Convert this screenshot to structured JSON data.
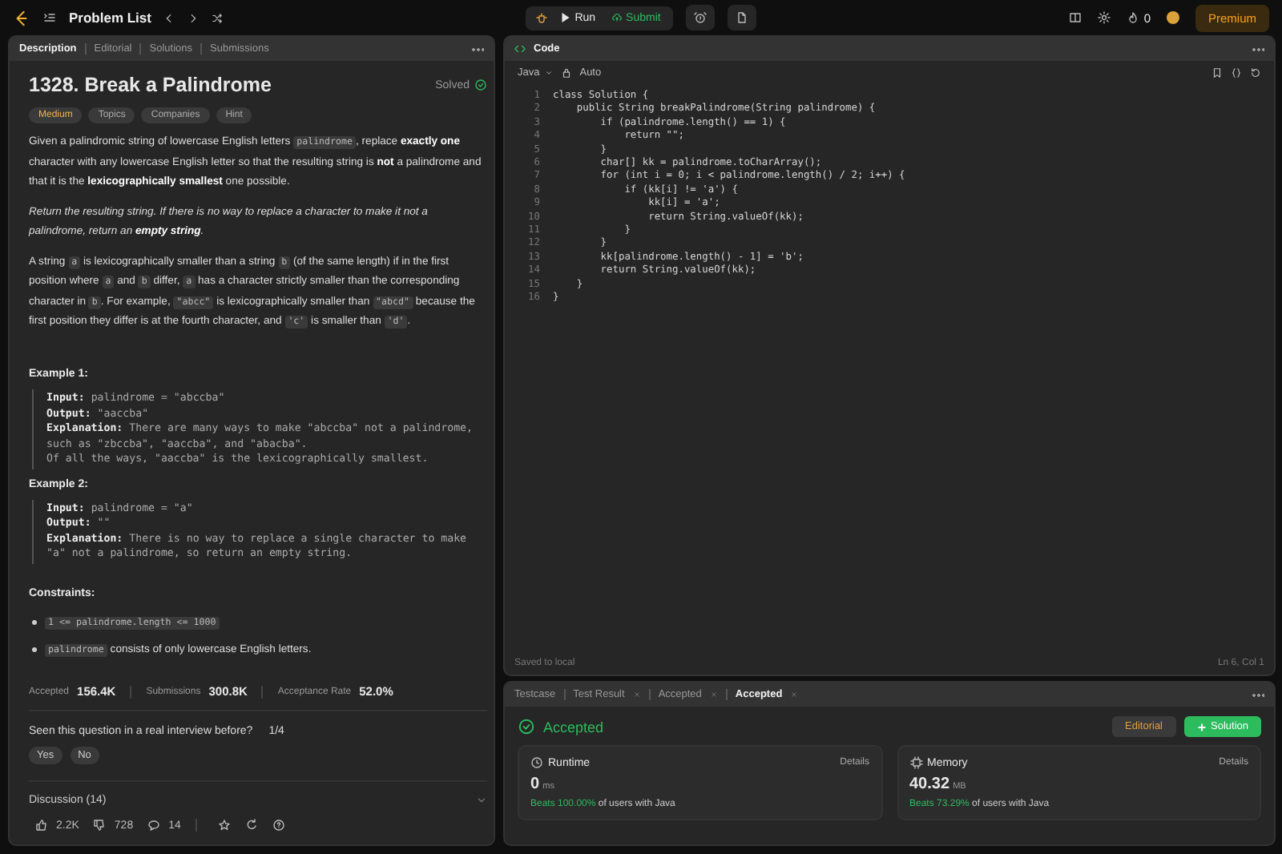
{
  "topbar": {
    "title": "Problem List",
    "run": "Run",
    "submit": "Submit",
    "streak": "0",
    "premium": "Premium"
  },
  "left_tabs": [
    {
      "label": "Description",
      "selected": true
    },
    {
      "label": "Editorial",
      "selected": false
    },
    {
      "label": "Solutions",
      "selected": false
    },
    {
      "label": "Submissions",
      "selected": false
    }
  ],
  "problem": {
    "title": "1328. Break a Palindrome",
    "status": "Solved",
    "difficulty": "Medium",
    "tags": [
      "Topics",
      "Companies",
      "Hint"
    ],
    "paragraphs": [
      [
        {
          "text": "Given a palindromic string of lowercase English letters ",
          "kind": "text"
        },
        {
          "text": "palindrome",
          "kind": "code"
        },
        {
          "text": ", replace ",
          "kind": "text"
        },
        {
          "text": "exactly one",
          "kind": "bold"
        },
        {
          "text": " character with any lowercase English letter so that the resulting string is ",
          "kind": "text"
        },
        {
          "text": "not",
          "kind": "bold"
        },
        {
          "text": " a palindrome and that it is the ",
          "kind": "text"
        },
        {
          "text": "lexicographically smallest",
          "kind": "bold"
        },
        {
          "text": " one possible.",
          "kind": "text"
        }
      ],
      [
        {
          "text": "Return the resulting string. If there is no way to replace a character to make it not a palindrome, return an ",
          "kind": "italic"
        },
        {
          "text": "empty string",
          "kind": "bold_italic"
        },
        {
          "text": ".",
          "kind": "italic"
        }
      ],
      [
        {
          "text": "A string ",
          "kind": "text"
        },
        {
          "text": "a",
          "kind": "code"
        },
        {
          "text": " is lexicographically smaller than a string ",
          "kind": "text"
        },
        {
          "text": "b",
          "kind": "code"
        },
        {
          "text": " (of the same length) if in the first position where ",
          "kind": "text"
        },
        {
          "text": "a",
          "kind": "code"
        },
        {
          "text": " and ",
          "kind": "text"
        },
        {
          "text": "b",
          "kind": "code"
        },
        {
          "text": " differ, ",
          "kind": "text"
        },
        {
          "text": "a",
          "kind": "code"
        },
        {
          "text": " has a character strictly smaller than the corresponding character in ",
          "kind": "text"
        },
        {
          "text": "b",
          "kind": "code"
        },
        {
          "text": ". For example, ",
          "kind": "text"
        },
        {
          "text": "\"abcc\"",
          "kind": "code"
        },
        {
          "text": " is lexicographically smaller than ",
          "kind": "text"
        },
        {
          "text": "\"abcd\"",
          "kind": "code"
        },
        {
          "text": " because the first position they differ is at the fourth character, and ",
          "kind": "text"
        },
        {
          "text": "'c'",
          "kind": "code"
        },
        {
          "text": " is smaller than ",
          "kind": "text"
        },
        {
          "text": "'d'",
          "kind": "code"
        },
        {
          "text": ".",
          "kind": "text"
        }
      ]
    ],
    "examples": [
      {
        "title": "Example 1:",
        "lines": [
          {
            "label": "Input:",
            "value": "palindrome = \"abccba\""
          },
          {
            "label": "Output:",
            "value": "\"aaccba\""
          },
          {
            "label": "Explanation:",
            "value": "There are many ways to make \"abccba\" not a palindrome, such as \"zbccba\", \"aaccba\", and \"abacba\".\nOf all the ways, \"aaccba\" is the lexicographically smallest."
          }
        ]
      },
      {
        "title": "Example 2:",
        "lines": [
          {
            "label": "Input:",
            "value": "palindrome = \"a\""
          },
          {
            "label": "Output:",
            "value": "\"\""
          },
          {
            "label": "Explanation:",
            "value": "There is no way to replace a single character to make \"a\" not a palindrome, so return an empty string."
          }
        ]
      }
    ],
    "constraints_title": "Constraints:",
    "constraints": [
      [
        {
          "text": "1 <= palindrome.length <= 1000",
          "kind": "code"
        }
      ],
      [
        {
          "text": "palindrome",
          "kind": "code"
        },
        {
          "text": " consists of only lowercase English letters.",
          "kind": "text"
        }
      ]
    ],
    "stats": [
      {
        "label": "Accepted",
        "value": "156.4K"
      },
      {
        "label": "Submissions",
        "value": "300.8K"
      },
      {
        "label": "Acceptance Rate",
        "value": "52.0%"
      }
    ],
    "interview": {
      "question": "Seen this question in a real interview before?",
      "count": "1/4",
      "answers": [
        "Yes",
        "No"
      ]
    },
    "discussion": "Discussion (14)",
    "footer": {
      "likes": "2.2K",
      "dislikes": "728",
      "comments": "14"
    }
  },
  "code_panel": {
    "title": "Code",
    "language": "Java",
    "mode": "Auto",
    "lines": [
      {
        "number": "1",
        "text": "class Solution {"
      },
      {
        "number": "2",
        "text": "    public String breakPalindrome(String palindrome) {"
      },
      {
        "number": "3",
        "text": "        if (palindrome.length() == 1) {"
      },
      {
        "number": "4",
        "text": "            return \"\";"
      },
      {
        "number": "5",
        "text": "        }"
      },
      {
        "number": "6",
        "text": "        char[] kk = palindrome.toCharArray();"
      },
      {
        "number": "7",
        "text": "        for (int i = 0; i < palindrome.length() / 2; i++) {"
      },
      {
        "number": "8",
        "text": "            if (kk[i] != 'a') {"
      },
      {
        "number": "9",
        "text": "                kk[i] = 'a';"
      },
      {
        "number": "10",
        "text": "                return String.valueOf(kk);"
      },
      {
        "number": "11",
        "text": "            }"
      },
      {
        "number": "12",
        "text": "        }"
      },
      {
        "number": "13",
        "text": "        kk[palindrome.length() - 1] = 'b';"
      },
      {
        "number": "14",
        "text": "        return String.valueOf(kk);"
      },
      {
        "number": "15",
        "text": "    }"
      },
      {
        "number": "16",
        "text": "}"
      }
    ],
    "saved": "Saved to local",
    "cursor": "Ln 6, Col 1"
  },
  "result_tabs": [
    {
      "label": "Testcase",
      "closable": false,
      "selected": false
    },
    {
      "label": "Test Result",
      "closable": true,
      "selected": false
    },
    {
      "label": "Accepted",
      "closable": true,
      "selected": false
    },
    {
      "label": "Accepted",
      "closable": true,
      "selected": true
    }
  ],
  "result": {
    "status": "Accepted",
    "editorial": "Editorial",
    "solution": "Solution",
    "cards": [
      {
        "kind": "runtime",
        "title": "Runtime",
        "details": "Details",
        "value": "0",
        "unit": "ms",
        "beats": "Beats 100.00%",
        "suffix": "of users with Java"
      },
      {
        "kind": "memory",
        "title": "Memory",
        "details": "Details",
        "value": "40.32",
        "unit": "MB",
        "beats": "Beats 73.29%",
        "suffix": "of users with Java"
      }
    ]
  }
}
